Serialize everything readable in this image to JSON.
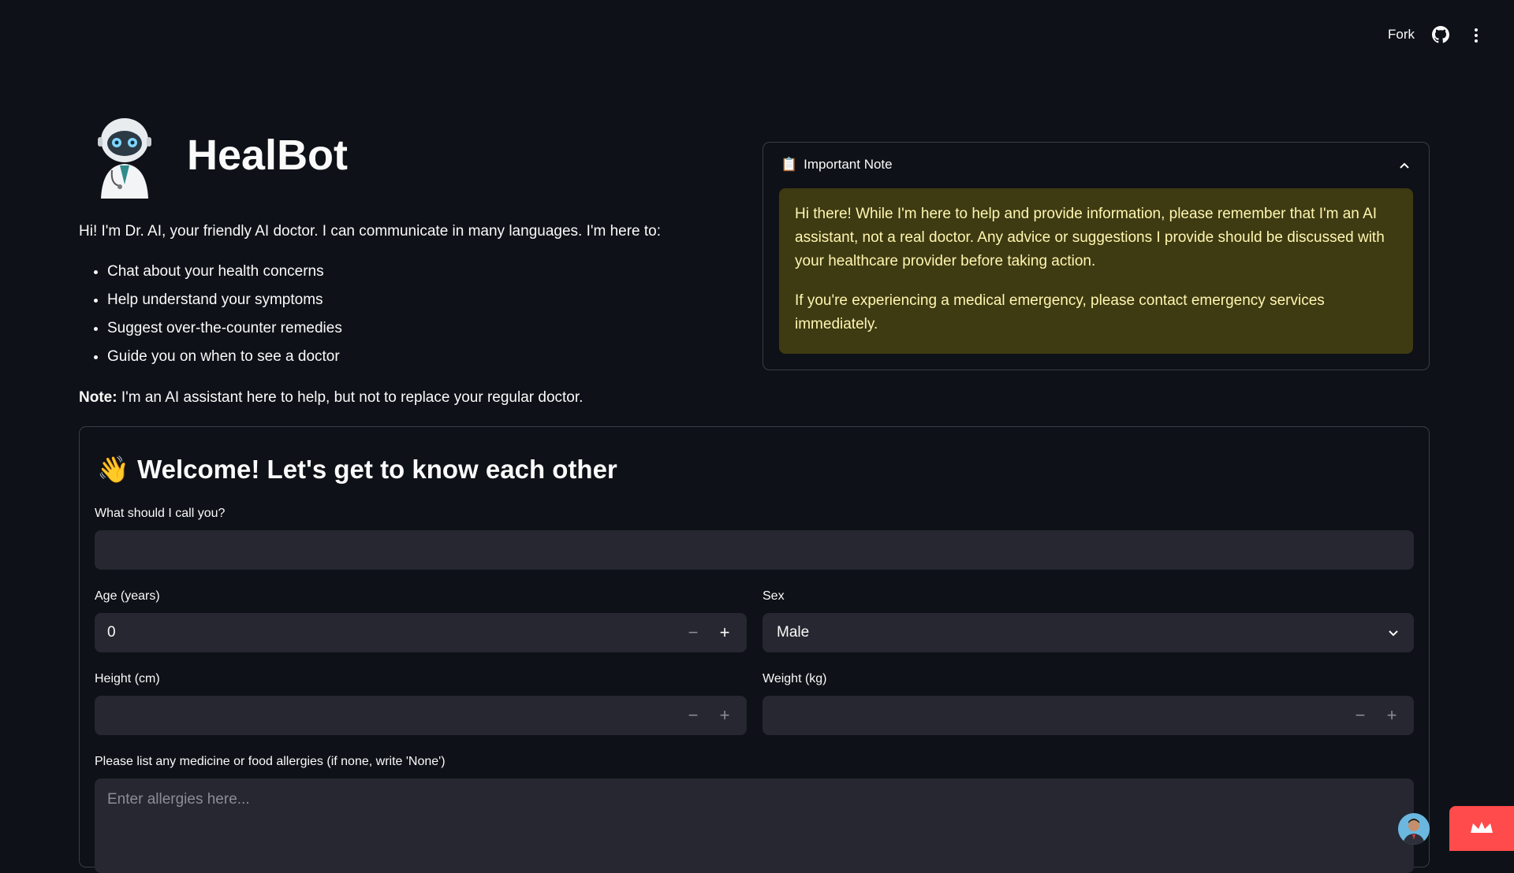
{
  "topbar": {
    "fork_label": "Fork",
    "github_icon": "github-icon",
    "menu_icon": "kebab-menu-icon"
  },
  "header": {
    "title": "HealBot",
    "robot_icon": "robot-doctor-icon"
  },
  "intro": {
    "text": "Hi! I'm Dr. AI, your friendly AI doctor. I can communicate in many languages. I'm here to:",
    "bullets": [
      "Chat about your health concerns",
      "Help understand your symptoms",
      "Suggest over-the-counter remedies",
      "Guide you on when to see a doctor"
    ],
    "note_label": "Note:",
    "note_text": " I'm an AI assistant here to help, but not to replace your regular doctor."
  },
  "important_note": {
    "emoji": "📋",
    "title": "Important Note",
    "paragraph1": "Hi there! While I'm here to help and provide information, please remember that I'm an AI assistant, not a real doctor. Any advice or suggestions I provide should be discussed with your healthcare provider before taking action.",
    "paragraph2": "If you're experiencing a medical emergency, please contact emergency services immediately.",
    "colors": {
      "bg": "#3e3a12",
      "text": "#fff6b0"
    }
  },
  "form": {
    "emoji": "👋",
    "heading": "Welcome! Let's get to know each other",
    "name_label": "What should I call you?",
    "name_value": "",
    "age_label": "Age (years)",
    "age_value": "0",
    "sex_label": "Sex",
    "sex_value": "Male",
    "height_label": "Height (cm)",
    "height_value": "",
    "weight_label": "Weight (kg)",
    "weight_value": "",
    "allergies_label": "Please list any medicine or food allergies (if none, write 'None')",
    "allergies_placeholder": "Enter allergies here...",
    "stepper_minus": "−",
    "stepper_plus": "+"
  },
  "theme": {
    "background": "#0e1117",
    "field_bg": "#262730",
    "accent": "#ff4b4b"
  }
}
